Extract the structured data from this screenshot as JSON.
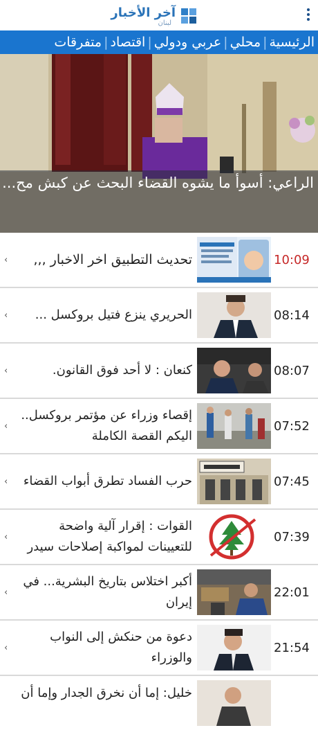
{
  "header": {
    "logo_title": "آخر الأخبار",
    "logo_subtitle": "لبنان"
  },
  "nav": {
    "items": [
      "الرئيسية",
      "محلي",
      "عربي ودولي",
      "اقتصاد",
      "متفرقات"
    ]
  },
  "hero": {
    "title": "الراعي: أسوأ ما يشوه القضاء البحث عن كبش مح..."
  },
  "news": [
    {
      "time": "10:09",
      "title": "تحديث التطبيق  اخر الاخبار ,,,",
      "highlight": true
    },
    {
      "time": "08:14",
      "title": "الحريري ينزع فتيل بروكسل ...",
      "highlight": false
    },
    {
      "time": "08:07",
      "title": "كنعان : لا أحد فوق القانون.",
      "highlight": false
    },
    {
      "time": "07:52",
      "title": "إقصاء وزراء عن مؤتمر بروكسل.. اليكم القصة الكاملة",
      "highlight": false
    },
    {
      "time": "07:45",
      "title": "حرب الفساد تطرق أبواب القضاء",
      "highlight": false
    },
    {
      "time": "07:39",
      "title": "القوات : إقرار آلية واضحة للتعيينات لمواكبة إصلاحات سيدر",
      "highlight": false
    },
    {
      "time": "22:01",
      "title": "أكبر اختلاس بتاريخ البشرية... في إيران",
      "highlight": false
    },
    {
      "time": "21:54",
      "title": "دعوة من حنكش إلى النواب والوزراء",
      "highlight": false
    },
    {
      "time": "",
      "title": "خليل: إما أن نخرق الجدار وإما أن",
      "highlight": false
    }
  ],
  "icons": {
    "menu": "more-vert-icon",
    "chevron": "chevron-left-icon"
  },
  "colors": {
    "nav_bg": "#1a75cf",
    "accent_time": "#c62828",
    "logo_blue": "#2a73b8"
  }
}
